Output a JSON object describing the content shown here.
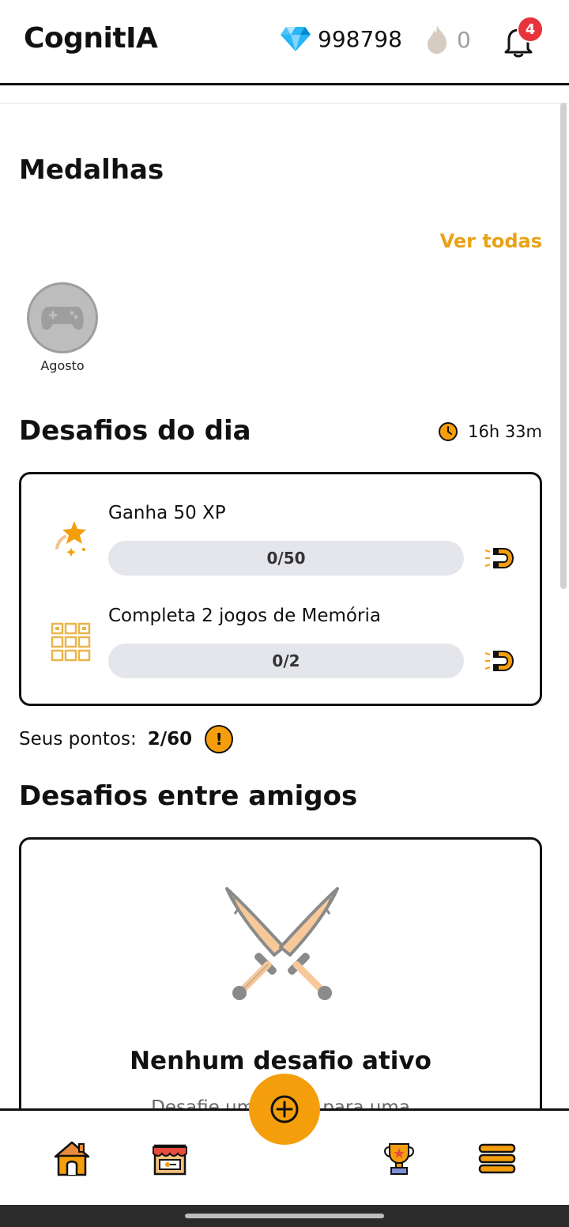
{
  "header": {
    "app_title": "CognitIA",
    "gems": "998798",
    "streak": "0",
    "notifications_badge": "4"
  },
  "medals": {
    "title": "Medalhas",
    "see_all": "Ver todas",
    "items": [
      {
        "label": "Agosto",
        "icon": "gamepad-icon"
      }
    ]
  },
  "daily": {
    "title": "Desafios do dia",
    "timer": "16h 33m",
    "challenges": [
      {
        "title": "Ganha 50 XP",
        "progress": "0/50",
        "fraction": 0,
        "icon": "star-sparkle-icon"
      },
      {
        "title": "Completa 2 jogos de Memória",
        "progress": "0/2",
        "fraction": 0,
        "icon": "memory-grid-icon"
      }
    ],
    "points_label": "Seus pontos:",
    "points_value": "2/60"
  },
  "friends": {
    "title": "Desafios entre amigos",
    "empty_title": "Nenhum desafio ativo",
    "empty_desc": "Desafie um amigo para uma"
  },
  "colors": {
    "accent": "#f59e0b",
    "link": "#e9a217",
    "badge": "#e8323c",
    "gem": "#1fb6ff"
  },
  "nav": {
    "items": [
      "home-icon",
      "store-icon",
      "add-icon",
      "trophy-icon",
      "menu-icon"
    ]
  }
}
